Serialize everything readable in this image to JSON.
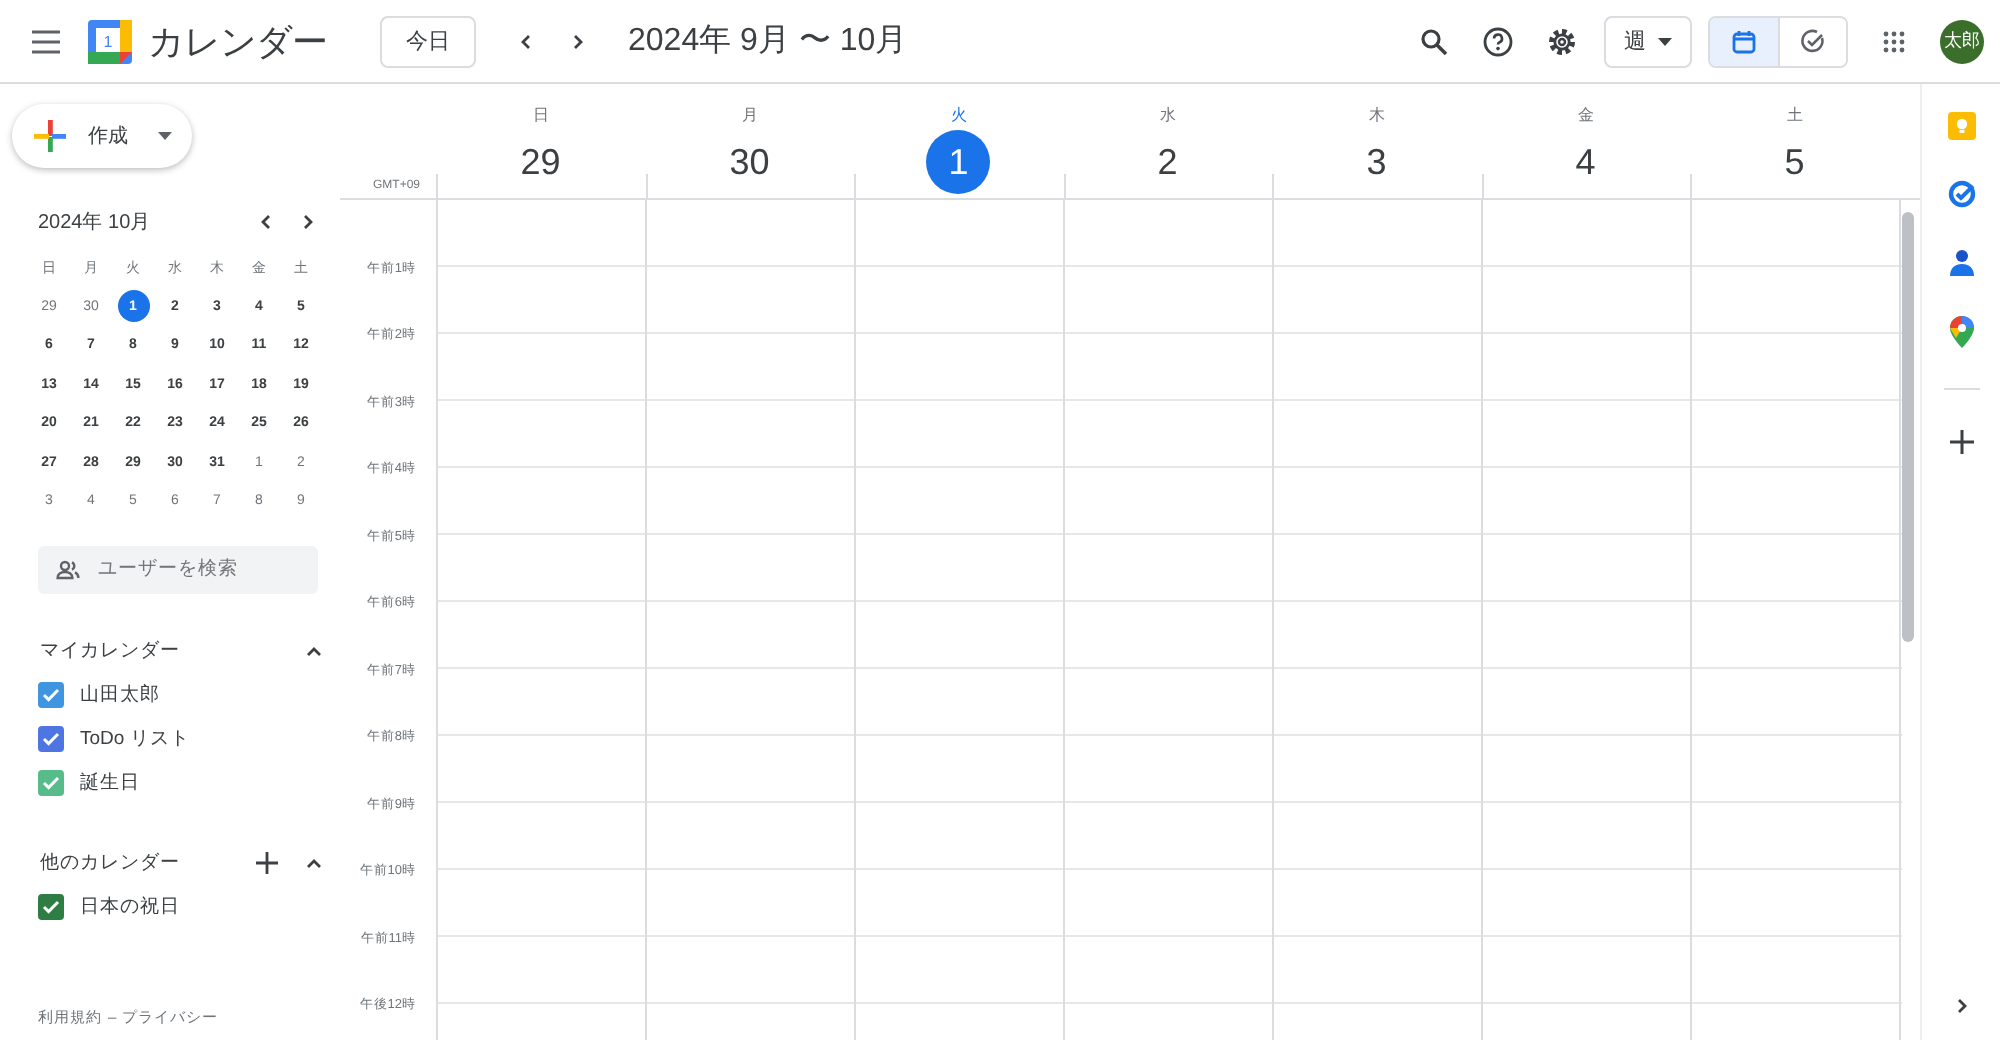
{
  "header": {
    "app_name": "カレンダー",
    "logo_day": "1",
    "today_button": "今日",
    "date_range": "2024年 9月 〜 10月",
    "view_select": "週",
    "view_toggle": [
      {
        "kind": "calendar",
        "selected": true
      },
      {
        "kind": "tasks",
        "selected": false
      }
    ],
    "avatar": "太郎"
  },
  "sidebar": {
    "create_button": "作成",
    "mini_calendar": {
      "title": "2024年 10月",
      "weekdays": [
        "日",
        "月",
        "火",
        "水",
        "木",
        "金",
        "土"
      ],
      "days": [
        {
          "label": "29",
          "muted": true,
          "selected": false
        },
        {
          "label": "30",
          "muted": true,
          "selected": false
        },
        {
          "label": "1",
          "muted": false,
          "selected": true
        },
        {
          "label": "2",
          "muted": false,
          "selected": false
        },
        {
          "label": "3",
          "muted": false,
          "selected": false
        },
        {
          "label": "4",
          "muted": false,
          "selected": false
        },
        {
          "label": "5",
          "muted": false,
          "selected": false
        },
        {
          "label": "6",
          "muted": false,
          "selected": false
        },
        {
          "label": "7",
          "muted": false,
          "selected": false
        },
        {
          "label": "8",
          "muted": false,
          "selected": false
        },
        {
          "label": "9",
          "muted": false,
          "selected": false
        },
        {
          "label": "10",
          "muted": false,
          "selected": false
        },
        {
          "label": "11",
          "muted": false,
          "selected": false
        },
        {
          "label": "12",
          "muted": false,
          "selected": false
        },
        {
          "label": "13",
          "muted": false,
          "selected": false
        },
        {
          "label": "14",
          "muted": false,
          "selected": false
        },
        {
          "label": "15",
          "muted": false,
          "selected": false
        },
        {
          "label": "16",
          "muted": false,
          "selected": false
        },
        {
          "label": "17",
          "muted": false,
          "selected": false
        },
        {
          "label": "18",
          "muted": false,
          "selected": false
        },
        {
          "label": "19",
          "muted": false,
          "selected": false
        },
        {
          "label": "20",
          "muted": false,
          "selected": false
        },
        {
          "label": "21",
          "muted": false,
          "selected": false
        },
        {
          "label": "22",
          "muted": false,
          "selected": false
        },
        {
          "label": "23",
          "muted": false,
          "selected": false
        },
        {
          "label": "24",
          "muted": false,
          "selected": false
        },
        {
          "label": "25",
          "muted": false,
          "selected": false
        },
        {
          "label": "26",
          "muted": false,
          "selected": false
        },
        {
          "label": "27",
          "muted": false,
          "selected": false
        },
        {
          "label": "28",
          "muted": false,
          "selected": false
        },
        {
          "label": "29",
          "muted": false,
          "selected": false
        },
        {
          "label": "30",
          "muted": false,
          "selected": false
        },
        {
          "label": "31",
          "muted": false,
          "selected": false
        },
        {
          "label": "1",
          "muted": true,
          "selected": false
        },
        {
          "label": "2",
          "muted": true,
          "selected": false
        },
        {
          "label": "3",
          "muted": true,
          "selected": false
        },
        {
          "label": "4",
          "muted": true,
          "selected": false
        },
        {
          "label": "5",
          "muted": true,
          "selected": false
        },
        {
          "label": "6",
          "muted": true,
          "selected": false
        },
        {
          "label": "7",
          "muted": true,
          "selected": false
        },
        {
          "label": "8",
          "muted": true,
          "selected": false
        },
        {
          "label": "9",
          "muted": true,
          "selected": false
        }
      ]
    },
    "people_search": {
      "placeholder": "ユーザーを検索"
    },
    "calendar_groups": [
      {
        "title": "マイカレンダー",
        "expanded": true,
        "can_add": false,
        "items": [
          {
            "label": "山田太郎",
            "checked": true,
            "color": "#3f95e0"
          },
          {
            "label": "ToDo リスト",
            "checked": true,
            "color": "#4f75e3"
          },
          {
            "label": "誕生日",
            "checked": true,
            "color": "#57bb8a"
          }
        ]
      },
      {
        "title": "他のカレンダー",
        "expanded": true,
        "can_add": true,
        "items": [
          {
            "label": "日本の祝日",
            "checked": true,
            "color": "#2e7d43"
          }
        ]
      }
    ],
    "footer": {
      "links": [
        "利用規約",
        "プライバシー"
      ],
      "separator": "–"
    }
  },
  "week": {
    "timezone": "GMT+09",
    "days": [
      {
        "weekday": "日",
        "date": "29",
        "selected": false
      },
      {
        "weekday": "月",
        "date": "30",
        "selected": false
      },
      {
        "weekday": "火",
        "date": "1",
        "selected": true
      },
      {
        "weekday": "水",
        "date": "2",
        "selected": false
      },
      {
        "weekday": "木",
        "date": "3",
        "selected": false
      },
      {
        "weekday": "金",
        "date": "4",
        "selected": false
      },
      {
        "weekday": "土",
        "date": "5",
        "selected": false
      }
    ],
    "hours": [
      "午前1時",
      "午前2時",
      "午前3時",
      "午前4時",
      "午前5時",
      "午前6時",
      "午前7時",
      "午前8時",
      "午前9時",
      "午前10時",
      "午前11時",
      "午後12時"
    ]
  }
}
